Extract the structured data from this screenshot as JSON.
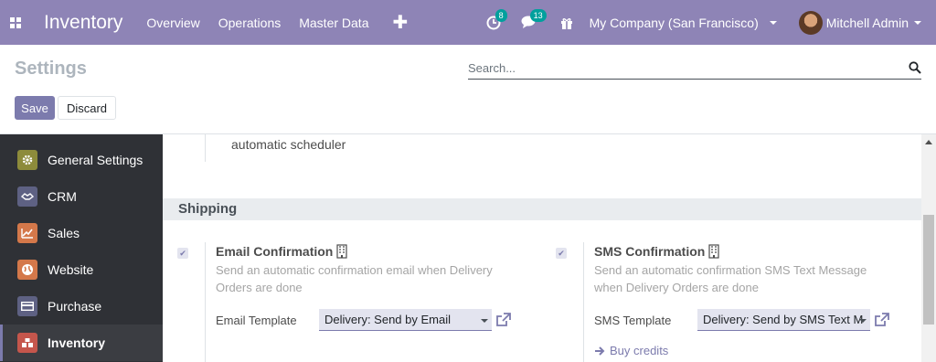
{
  "navbar": {
    "app_title": "Inventory",
    "menu": [
      "Overview",
      "Operations",
      "Master Data"
    ],
    "activity_count": "8",
    "messages_count": "13",
    "company": "My Company (San Francisco)",
    "user": "Mitchell Admin",
    "bg_color": "#8e84b6"
  },
  "control_panel": {
    "title": "Settings",
    "search_placeholder": "Search...",
    "save_label": "Save",
    "discard_label": "Discard"
  },
  "sidebar": {
    "items": [
      {
        "label": "General Settings",
        "icon": "gear-icon",
        "color": "#8d8b3b"
      },
      {
        "label": "CRM",
        "icon": "handshake-icon",
        "color": "#5e6183"
      },
      {
        "label": "Sales",
        "icon": "chart-icon",
        "color": "#d4784a"
      },
      {
        "label": "Website",
        "icon": "globe-icon",
        "color": "#d4784a"
      },
      {
        "label": "Purchase",
        "icon": "card-icon",
        "color": "#5e6183"
      },
      {
        "label": "Inventory",
        "icon": "boxes-icon",
        "color": "#c5564c"
      }
    ]
  },
  "content": {
    "prev_text": "automatic scheduler",
    "section": "Shipping",
    "email": {
      "title": "Email Confirmation",
      "desc": "Send an automatic confirmation email when Delivery Orders are done",
      "template_label": "Email Template",
      "template_value": "Delivery: Send by Email"
    },
    "sms": {
      "title": "SMS Confirmation",
      "desc": "Send an automatic confirmation SMS Text Message when Delivery Orders are done",
      "template_label": "SMS Template",
      "template_value": "Delivery: Send by SMS Text M",
      "buy_credits": "Buy credits"
    }
  }
}
